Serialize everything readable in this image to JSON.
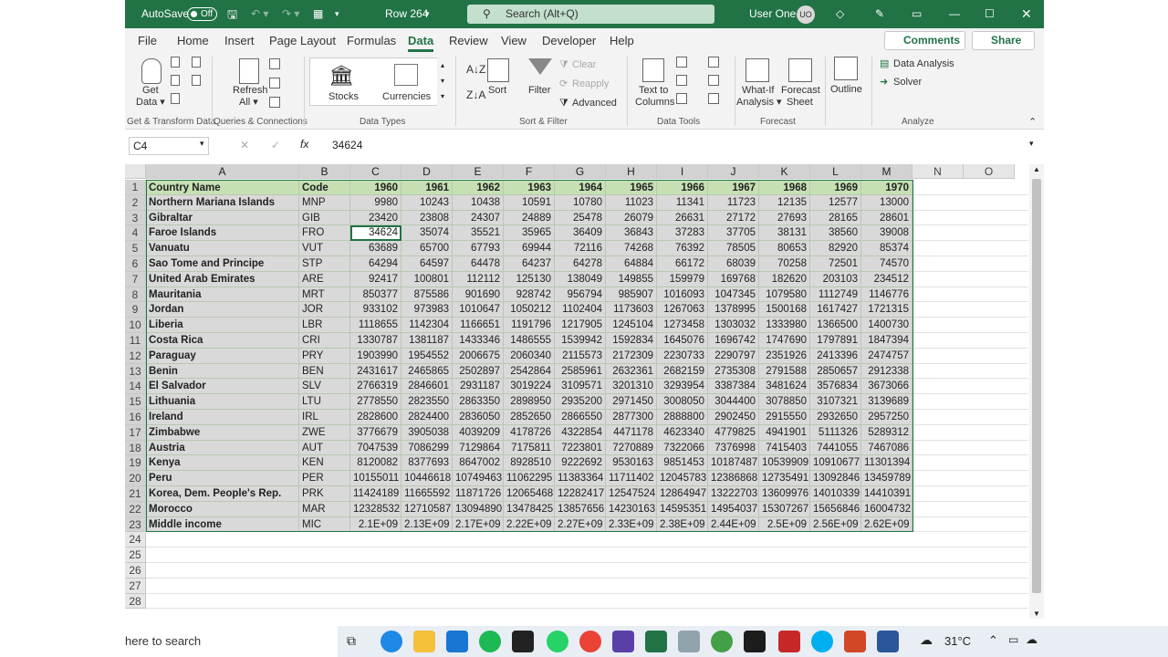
{
  "titlebar": {
    "autosave": "AutoSave",
    "toggle": "Off",
    "doc": "Row 264",
    "search_placeholder": "Search (Alt+Q)",
    "user": "User One",
    "avatar": "UO"
  },
  "tabs": [
    "File",
    "Home",
    "Insert",
    "Page Layout",
    "Formulas",
    "Data",
    "Review",
    "View",
    "Developer",
    "Help"
  ],
  "active_tab": "Data",
  "comments": "Comments",
  "share": "Share",
  "ribbon": {
    "get_data": "Get",
    "get_data2": "Data ▾",
    "refresh": "Refresh",
    "refresh2": "All ▾",
    "stocks": "Stocks",
    "currencies": "Currencies",
    "sort": "Sort",
    "filter": "Filter",
    "clear": "Clear",
    "reapply": "Reapply",
    "advanced": "Advanced",
    "ttc": "Text to",
    "ttc2": "Columns",
    "whatif": "What-If",
    "whatif2": "Analysis ▾",
    "forecast": "Forecast",
    "forecast2": "Sheet",
    "outline": "Outline",
    "data_analysis": "Data Analysis",
    "solver": "Solver",
    "groups": [
      "Get & Transform Data",
      "Queries & Connections",
      "Data Types",
      "Sort & Filter",
      "Data Tools",
      "Forecast",
      "Analyze"
    ]
  },
  "namebox": "C4",
  "fx": "fx",
  "formula": "34624",
  "columns": [
    "A",
    "B",
    "C",
    "D",
    "E",
    "F",
    "G",
    "H",
    "I",
    "J",
    "K",
    "L",
    "M",
    "N",
    "O"
  ],
  "header_row": [
    "Country Name",
    "Code",
    "1960",
    "1961",
    "1962",
    "1963",
    "1964",
    "1965",
    "1966",
    "1967",
    "1968",
    "1969",
    "1970"
  ],
  "rows": [
    [
      "Northern Mariana Islands",
      "MNP",
      "9980",
      "10243",
      "10438",
      "10591",
      "10780",
      "11023",
      "11341",
      "11723",
      "12135",
      "12577",
      "13000"
    ],
    [
      "Gibraltar",
      "GIB",
      "23420",
      "23808",
      "24307",
      "24889",
      "25478",
      "26079",
      "26631",
      "27172",
      "27693",
      "28165",
      "28601"
    ],
    [
      "Faroe Islands",
      "FRO",
      "34624",
      "35074",
      "35521",
      "35965",
      "36409",
      "36843",
      "37283",
      "37705",
      "38131",
      "38560",
      "39008"
    ],
    [
      "Vanuatu",
      "VUT",
      "63689",
      "65700",
      "67793",
      "69944",
      "72116",
      "74268",
      "76392",
      "78505",
      "80653",
      "82920",
      "85374"
    ],
    [
      "Sao Tome and Principe",
      "STP",
      "64294",
      "64597",
      "64478",
      "64237",
      "64278",
      "64884",
      "66172",
      "68039",
      "70258",
      "72501",
      "74570"
    ],
    [
      "United Arab Emirates",
      "ARE",
      "92417",
      "100801",
      "112112",
      "125130",
      "138049",
      "149855",
      "159979",
      "169768",
      "182620",
      "203103",
      "234512"
    ],
    [
      "Mauritania",
      "MRT",
      "850377",
      "875586",
      "901690",
      "928742",
      "956794",
      "985907",
      "1016093",
      "1047345",
      "1079580",
      "1112749",
      "1146776"
    ],
    [
      "Jordan",
      "JOR",
      "933102",
      "973983",
      "1010647",
      "1050212",
      "1102404",
      "1173603",
      "1267063",
      "1378995",
      "1500168",
      "1617427",
      "1721315"
    ],
    [
      "Liberia",
      "LBR",
      "1118655",
      "1142304",
      "1166651",
      "1191796",
      "1217905",
      "1245104",
      "1273458",
      "1303032",
      "1333980",
      "1366500",
      "1400730"
    ],
    [
      "Costa Rica",
      "CRI",
      "1330787",
      "1381187",
      "1433346",
      "1486555",
      "1539942",
      "1592834",
      "1645076",
      "1696742",
      "1747690",
      "1797891",
      "1847394"
    ],
    [
      "Paraguay",
      "PRY",
      "1903990",
      "1954552",
      "2006675",
      "2060340",
      "2115573",
      "2172309",
      "2230733",
      "2290797",
      "2351926",
      "2413396",
      "2474757"
    ],
    [
      "Benin",
      "BEN",
      "2431617",
      "2465865",
      "2502897",
      "2542864",
      "2585961",
      "2632361",
      "2682159",
      "2735308",
      "2791588",
      "2850657",
      "2912338"
    ],
    [
      "El Salvador",
      "SLV",
      "2766319",
      "2846601",
      "2931187",
      "3019224",
      "3109571",
      "3201310",
      "3293954",
      "3387384",
      "3481624",
      "3576834",
      "3673066"
    ],
    [
      "Lithuania",
      "LTU",
      "2778550",
      "2823550",
      "2863350",
      "2898950",
      "2935200",
      "2971450",
      "3008050",
      "3044400",
      "3078850",
      "3107321",
      "3139689"
    ],
    [
      "Ireland",
      "IRL",
      "2828600",
      "2824400",
      "2836050",
      "2852650",
      "2866550",
      "2877300",
      "2888800",
      "2902450",
      "2915550",
      "2932650",
      "2957250"
    ],
    [
      "Zimbabwe",
      "ZWE",
      "3776679",
      "3905038",
      "4039209",
      "4178726",
      "4322854",
      "4471178",
      "4623340",
      "4779825",
      "4941901",
      "5111326",
      "5289312"
    ],
    [
      "Austria",
      "AUT",
      "7047539",
      "7086299",
      "7129864",
      "7175811",
      "7223801",
      "7270889",
      "7322066",
      "7376998",
      "7415403",
      "7441055",
      "7467086"
    ],
    [
      "Kenya",
      "KEN",
      "8120082",
      "8377693",
      "8647002",
      "8928510",
      "9222692",
      "9530163",
      "9851453",
      "10187487",
      "10539909",
      "10910677",
      "11301394"
    ],
    [
      "Peru",
      "PER",
      "10155011",
      "10446618",
      "10749463",
      "11062295",
      "11383364",
      "11711402",
      "12045783",
      "12386868",
      "12735491",
      "13092846",
      "13459789"
    ],
    [
      "Korea, Dem. People's Rep.",
      "PRK",
      "11424189",
      "11665592",
      "11871726",
      "12065468",
      "12282417",
      "12547524",
      "12864947",
      "13222703",
      "13609976",
      "14010339",
      "14410391"
    ],
    [
      "Morocco",
      "MAR",
      "12328532",
      "12710587",
      "13094890",
      "13478425",
      "13857656",
      "14230163",
      "14595351",
      "14954037",
      "15307267",
      "15656846",
      "16004732"
    ],
    [
      "Middle income",
      "MIC",
      "2.1E+09",
      "2.13E+09",
      "2.17E+09",
      "2.22E+09",
      "2.27E+09",
      "2.33E+09",
      "2.38E+09",
      "2.44E+09",
      "2.5E+09",
      "2.56E+09",
      "2.62E+09"
    ]
  ],
  "row_numbers": [
    "1",
    "2",
    "3",
    "4",
    "5",
    "6",
    "7",
    "8",
    "9",
    "10",
    "11",
    "12",
    "13",
    "14",
    "15",
    "16",
    "17",
    "18",
    "19",
    "20",
    "21",
    "22",
    "23",
    "24",
    "25",
    "26",
    "27",
    "28"
  ],
  "taskbar": {
    "search": "here to search",
    "temp": "31°C"
  },
  "colors": {
    "excel_green": "#217346",
    "selection_fill": "#d9d9d9",
    "header_fill": "#c6e0b4"
  }
}
